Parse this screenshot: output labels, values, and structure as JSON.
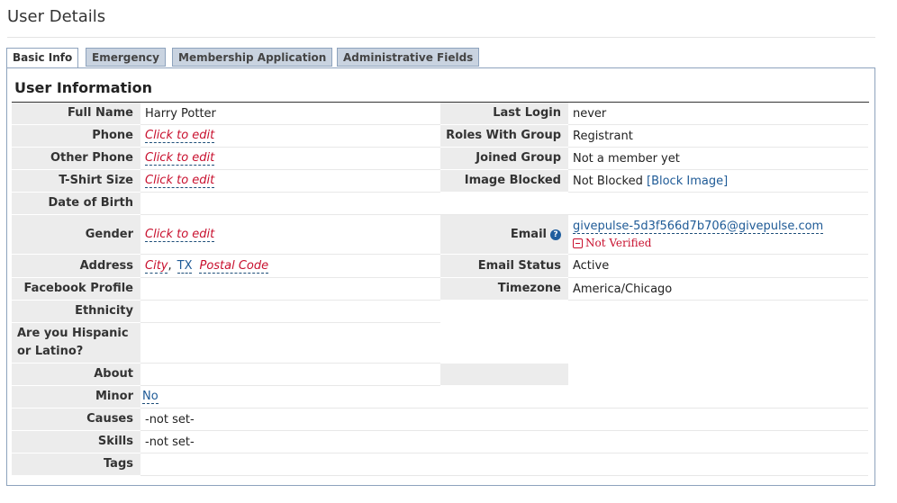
{
  "page_title": "User Details",
  "tabs": [
    {
      "label": "Basic Info"
    },
    {
      "label": "Emergency"
    },
    {
      "label": "Membership Application"
    },
    {
      "label": "Administrative Fields"
    }
  ],
  "section_title": "User Information",
  "left": {
    "full_name": {
      "label": "Full Name",
      "value": "Harry Potter"
    },
    "phone": {
      "label": "Phone",
      "value": "Click to edit"
    },
    "other_phone": {
      "label": "Other Phone",
      "value": "Click to edit"
    },
    "tshirt": {
      "label": "T-Shirt Size",
      "value": "Click to edit"
    },
    "dob": {
      "label": "Date of Birth",
      "value": ""
    },
    "gender": {
      "label": "Gender",
      "value": "Click to edit"
    },
    "address": {
      "label": "Address",
      "city": "City",
      "state": "TX",
      "postal": "Postal Code"
    },
    "facebook": {
      "label": "Facebook Profile",
      "value": ""
    },
    "ethnicity": {
      "label": "Ethnicity",
      "value": ""
    },
    "hispanic": {
      "label": "Are you Hispanic or Latino?",
      "value": ""
    },
    "about": {
      "label": "About",
      "value": ""
    },
    "minor": {
      "label": "Minor",
      "value": "No"
    },
    "causes": {
      "label": "Causes",
      "value": "-not set-"
    },
    "skills": {
      "label": "Skills",
      "value": "-not set-"
    },
    "tags": {
      "label": "Tags",
      "value": ""
    }
  },
  "right": {
    "last_login": {
      "label": "Last Login",
      "value": "never"
    },
    "roles": {
      "label": "Roles With Group",
      "value": "Registrant"
    },
    "joined": {
      "label": "Joined Group",
      "value": "Not a member yet"
    },
    "image_blocked": {
      "label": "Image Blocked",
      "value": "Not Blocked",
      "action": "[Block Image]"
    },
    "email": {
      "label": "Email",
      "value": "givepulse-5d3f566d7b706@givepulse.com",
      "status_note": "Not Verified"
    },
    "email_status": {
      "label": "Email Status",
      "value": "Active"
    },
    "timezone": {
      "label": "Timezone",
      "value": "America/Chicago"
    }
  },
  "colors": {
    "tab_bg": "#c9d3e0",
    "label_bg": "#ececec",
    "edit_red": "#c8102e",
    "link_blue": "#1e5a96"
  }
}
